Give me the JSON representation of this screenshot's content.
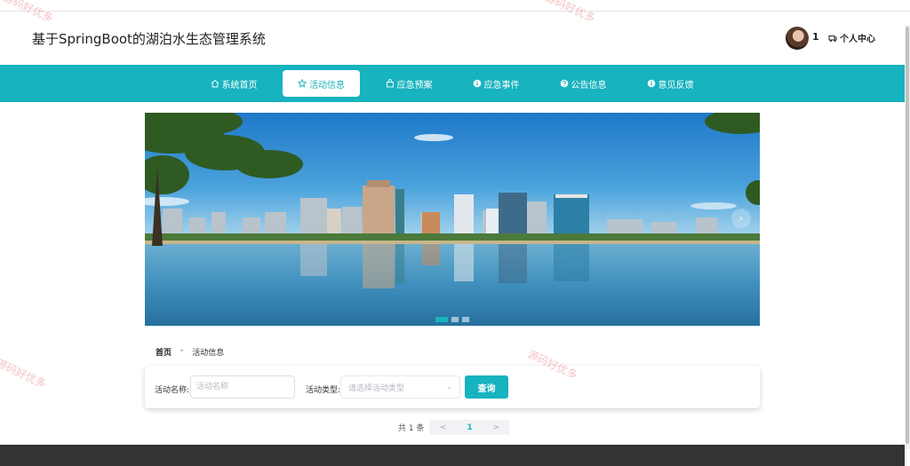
{
  "header": {
    "site_title": "基于SpringBoot的湖泊水生态管理系统",
    "username": "1",
    "user_center_label": "个人中心"
  },
  "nav": {
    "items": [
      {
        "label": "系统首页",
        "icon": "home-icon"
      },
      {
        "label": "活动信息",
        "icon": "star-icon",
        "active": true
      },
      {
        "label": "应急预案",
        "icon": "bag-icon"
      },
      {
        "label": "应急事件",
        "icon": "info-icon"
      },
      {
        "label": "公告信息",
        "icon": "question-icon"
      },
      {
        "label": "意见反馈",
        "icon": "info-icon"
      }
    ]
  },
  "carousel": {
    "slide_count": 3,
    "active_index": 0,
    "next_arrow": "›"
  },
  "breadcrumb": {
    "home": "首页",
    "separator": "-",
    "current": "活动信息"
  },
  "search": {
    "name_label": "活动名称:",
    "name_placeholder": "活动名称",
    "type_label": "活动类型:",
    "type_placeholder": "请选择活动类型",
    "query_label": "查询"
  },
  "pagination": {
    "total_text": "共 1 条",
    "prev": "<",
    "current_page": "1",
    "next": ">"
  },
  "watermark": {
    "text": "源码好优多"
  },
  "colors": {
    "accent": "#17b3be",
    "footer": "#333333"
  }
}
